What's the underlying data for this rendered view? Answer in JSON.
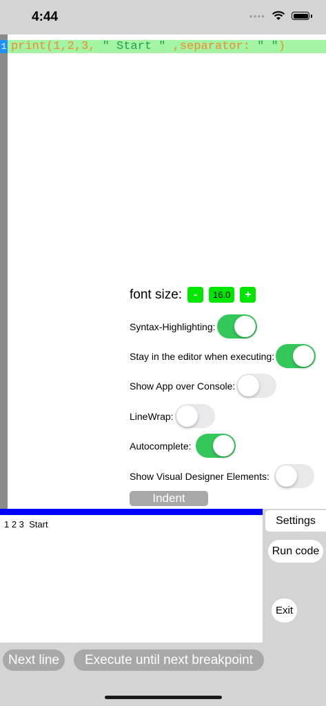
{
  "status_bar": {
    "time": "4:44"
  },
  "editor": {
    "line_number": "1",
    "code_line": {
      "prefix": "print(1,2,3, ",
      "string1": "\" Start \"",
      "middle": " ,separator: ",
      "string2": "\" \"",
      "suffix": ")"
    }
  },
  "settings": {
    "font_size_label": "font size:",
    "font_minus": "-",
    "font_value": "16.0",
    "font_plus": "+",
    "syntax_label": "Syntax-Highlighting:",
    "syntax_on": true,
    "stay_label": "Stay in the editor when executing:",
    "stay_on": true,
    "show_app_label": "Show App over Console:",
    "show_app_on": false,
    "linewrap_label": "LineWrap:",
    "linewrap_on": false,
    "autocomplete_label": "Autocomplete:",
    "autocomplete_on": true,
    "visual_label": "Show Visual Designer Elements:",
    "visual_on": false,
    "indent_label": "Indent"
  },
  "console": {
    "output": "1 2 3  Start"
  },
  "side_buttons": {
    "settings": "Settings",
    "run": "Run code",
    "exit": "Exit"
  },
  "bottom_buttons": {
    "next_line": "Next line",
    "execute": "Execute until next breakpoint"
  },
  "colors": {
    "accent_green": "#00e600",
    "toggle_on": "#34c759",
    "console_bar": "#0000ff",
    "line_highlight": "#a3f4a3"
  }
}
